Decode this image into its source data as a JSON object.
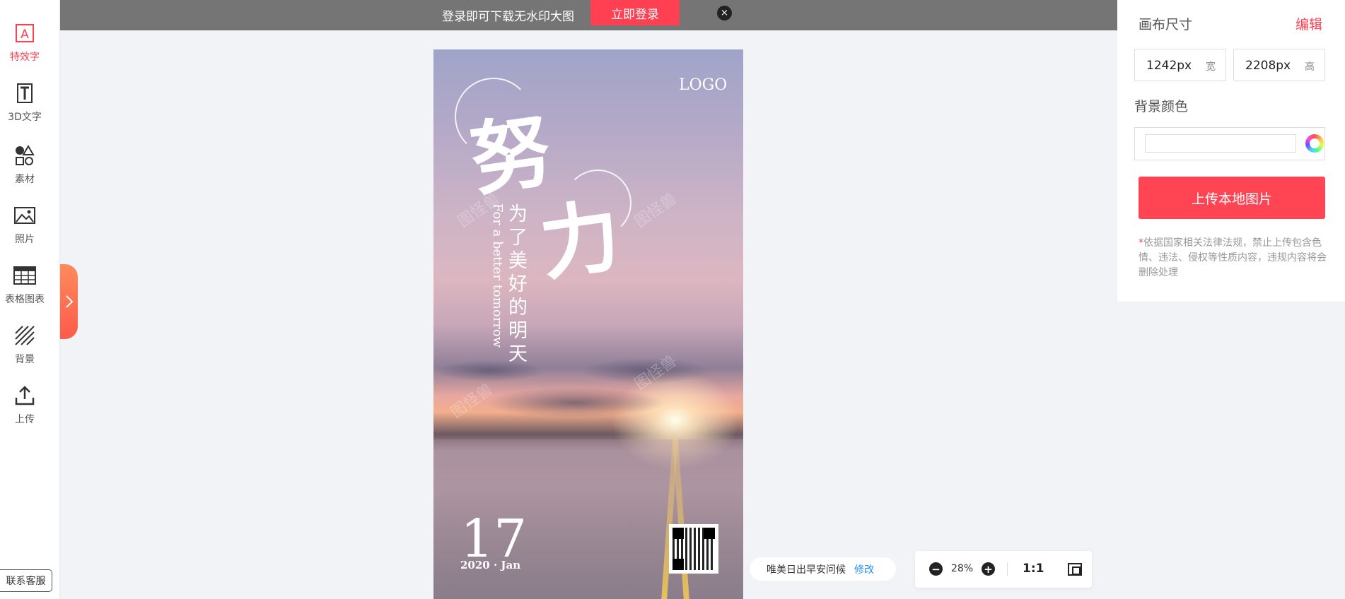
{
  "left_toolbar": {
    "items": [
      {
        "label": "特效字",
        "icon": "text-effect-icon",
        "active": true
      },
      {
        "label": "3D文字",
        "icon": "3d-text-icon"
      },
      {
        "label": "素材",
        "icon": "shapes-icon"
      },
      {
        "label": "照片",
        "icon": "image-icon"
      },
      {
        "label": "表格图表",
        "icon": "table-icon"
      },
      {
        "label": "背景",
        "icon": "background-pattern-icon"
      },
      {
        "label": "上传",
        "icon": "upload-icon"
      }
    ],
    "contact_label": "联系客服",
    "expand_icon": "chevron-right-icon"
  },
  "banner": {
    "text": "登录即可下载无水印大图",
    "login_label": "立即登录",
    "close_glyph": "×"
  },
  "poster": {
    "logo": "LOGO",
    "headline_1": "努",
    "headline_2": "力",
    "subtitle_cn": "为了美好的明天",
    "subtitle_en": "For a better tomorrow",
    "day": "17",
    "date": "2020 · Jan",
    "watermark": "图怪兽"
  },
  "template_bar": {
    "name": "唯美日出早安问候",
    "edit_label": "修改"
  },
  "zoom_bar": {
    "minus": "−",
    "value": "28%",
    "plus": "+",
    "ratio_label": "1:1"
  },
  "right_panel": {
    "title": "画布尺寸",
    "edit_label": "编辑",
    "width_value": "1242px",
    "width_unit": "宽",
    "height_value": "2208px",
    "height_unit": "高",
    "bg_color_label": "背景颜色",
    "upload_label": "上传本地图片",
    "notice_star": "*",
    "notice_text": "依据国家相关法律法规，禁止上传包含色情、违法、侵权等性质内容，违规内容将会删除处理"
  },
  "colors": {
    "accent": "#ff4052",
    "banner_bg": "#757575",
    "link": "#1e8fff"
  }
}
